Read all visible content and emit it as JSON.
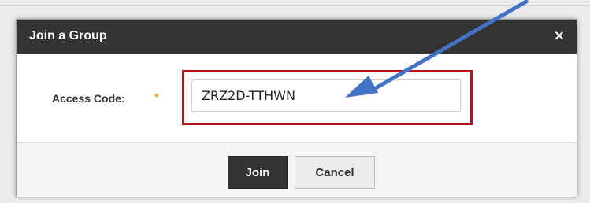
{
  "dialog": {
    "title": "Join a Group",
    "close_icon": "close-icon",
    "close_glyph": "×"
  },
  "form": {
    "access_code_label": "Access Code:",
    "required_marker": "*",
    "access_code_value": "ZRZ2D-TTHWN"
  },
  "buttons": {
    "join_label": "Join",
    "cancel_label": "Cancel"
  },
  "annotation": {
    "arrow_color": "#4472c4",
    "highlight_color": "#b5121b"
  }
}
